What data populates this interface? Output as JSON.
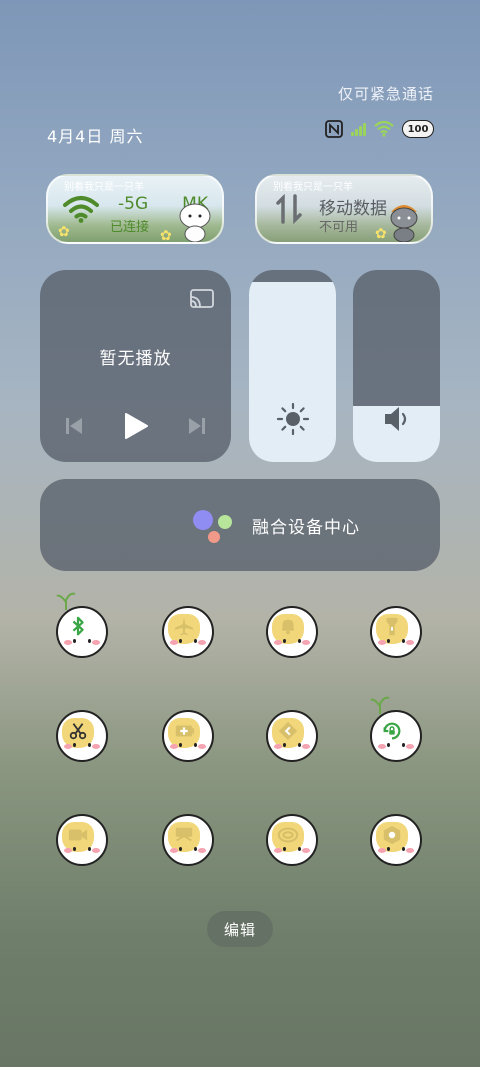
{
  "header": {
    "emergency_text": "仅可紧急通话",
    "date": "4月4日 周六",
    "battery": "100"
  },
  "wifi_pill": {
    "motto": "别看我只是一只羊",
    "network": "-5G",
    "network_suffix": "MK",
    "status": "已连接"
  },
  "mobile_pill": {
    "motto": "别看我只是一只羊",
    "title": "移动数据",
    "status": "不可用"
  },
  "media": {
    "title": "暂无播放"
  },
  "sliders": {
    "brightness_level": 0.94,
    "volume_level": 0.29
  },
  "fusion": {
    "label": "融合设备中心"
  },
  "tiles": [
    {
      "name": "bluetooth-toggle",
      "icon": "bluetooth-icon",
      "active": true
    },
    {
      "name": "airplane-mode-toggle",
      "icon": "airplane-icon",
      "active": false
    },
    {
      "name": "ring-mode-toggle",
      "icon": "bell-icon",
      "active": false
    },
    {
      "name": "flashlight-toggle",
      "icon": "flashlight-icon",
      "active": false
    },
    {
      "name": "screenshot-toggle",
      "icon": "scissors-icon",
      "active": false
    },
    {
      "name": "battery-saver-toggle",
      "icon": "battery-plus-icon",
      "active": false
    },
    {
      "name": "location-toggle",
      "icon": "location-icon",
      "active": false
    },
    {
      "name": "auto-rotate-toggle",
      "icon": "rotate-lock-icon",
      "active": true
    },
    {
      "name": "screen-record-toggle",
      "icon": "video-camera-icon",
      "active": false
    },
    {
      "name": "eye-comfort-toggle",
      "icon": "eye-comfort-icon",
      "active": false
    },
    {
      "name": "share-toggle",
      "icon": "share-icon",
      "active": false
    },
    {
      "name": "settings-toggle",
      "icon": "hexagon-nut-icon",
      "active": false
    }
  ],
  "edit_label": "编辑",
  "colors": {
    "accent_green": "#4f8a2b",
    "panel": "#58606c",
    "slider_fill": "#e3edf6"
  }
}
